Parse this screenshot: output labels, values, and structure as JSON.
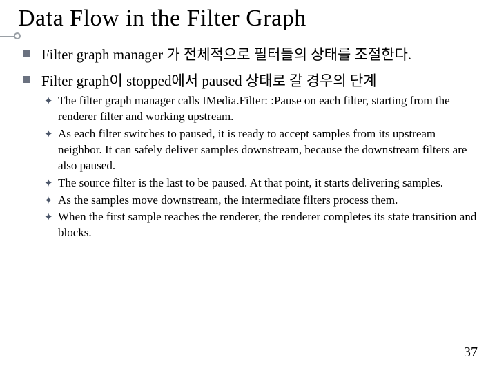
{
  "title": "Data Flow in the Filter Graph",
  "bullets": [
    {
      "text": "Filter graph manager 가 전체적으로 필터들의 상태를 조절한다."
    },
    {
      "text": "Filter graph이 stopped에서 paused 상태로 갈 경우의 단계",
      "children": [
        "The filter graph manager calls IMedia.Filter: :Pause on each filter, starting from the renderer filter and working upstream.",
        "As each filter switches to paused, it is ready to accept samples from its upstream neighbor. It can safely deliver samples downstream, because the downstream filters are also paused.",
        "The source filter is the last to be paused. At that point, it starts delivering samples.",
        "As the samples move downstream, the intermediate filters process them.",
        "When the first sample reaches the renderer, the renderer completes its state transition and blocks."
      ]
    }
  ],
  "page_number": "37"
}
